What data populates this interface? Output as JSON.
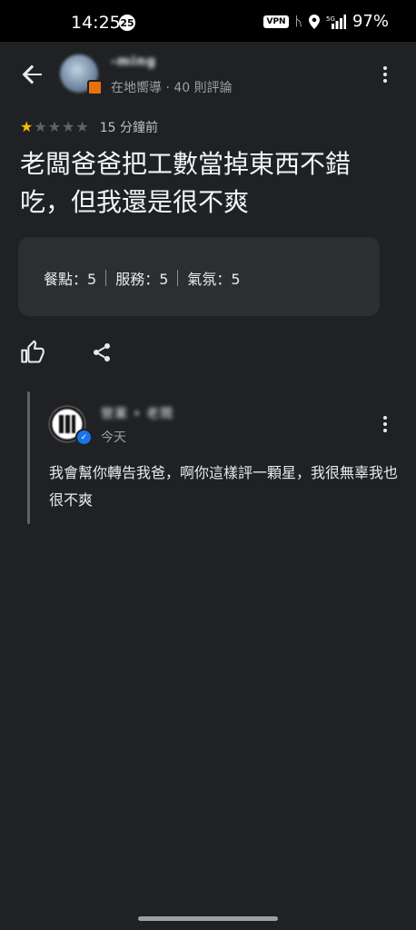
{
  "status_bar": {
    "time": "14:25",
    "notification_count": "25",
    "vpn": "VPN",
    "network": "5G",
    "battery": "97%"
  },
  "header": {
    "reviewer_name": "-ming",
    "reviewer_meta": "在地嚮導 · 40 則評論"
  },
  "review": {
    "rating": 1,
    "max_rating": 5,
    "time_ago": "15 分鐘前",
    "text": "老闆爸爸把工數當掉東西不錯吃，但我還是很不爽",
    "attributes": [
      {
        "label": "餐點：5"
      },
      {
        "label": "服務：5"
      },
      {
        "label": "氣氛：5"
      }
    ]
  },
  "owner_reply": {
    "name": "營業 • 老闆",
    "date": "今天",
    "text": "我會幫你轉告我爸，啊你這樣評一顆星，我很無辜我也很不爽"
  },
  "colors": {
    "background": "#202124",
    "star_on": "#fbbc04",
    "star_off": "#5f6368",
    "card": "#2d2e31",
    "verified": "#1a73e8"
  },
  "icons": [
    "back-arrow-icon",
    "more-vert-icon",
    "thumbs-up-icon",
    "share-icon",
    "verified-badge-icon"
  ]
}
